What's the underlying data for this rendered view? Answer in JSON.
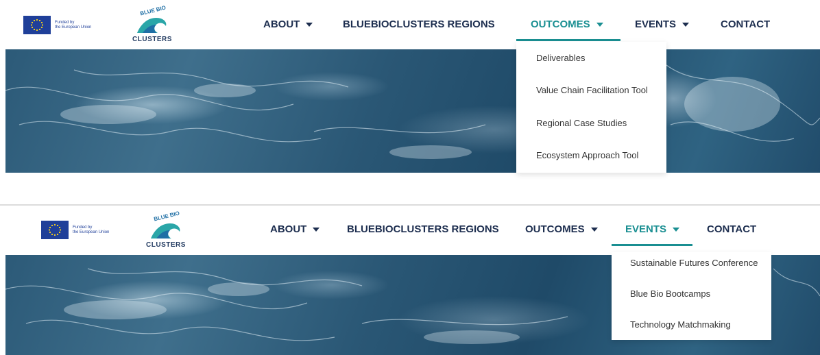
{
  "eu_logo": {
    "line1": "Funded by",
    "line2": "the European Union",
    "icon": "eu-flag-icon"
  },
  "brand": {
    "arc_text": "BLUE BIO",
    "name": "CLUSTERS",
    "icon": "wave-icon"
  },
  "screens": [
    {
      "nav": [
        {
          "label": "ABOUT"
        },
        {
          "label": "BLUEBIOCLUSTERS REGIONS"
        },
        {
          "label": "OUTCOMES"
        },
        {
          "label": "EVENTS"
        },
        {
          "label": "CONTACT"
        }
      ],
      "active": "OUTCOMES",
      "dropdown": [
        "Deliverables",
        "Value Chain Facilitation Tool",
        "Regional Case Studies",
        "Ecosystem Approach Tool"
      ]
    },
    {
      "nav": [
        {
          "label": "ABOUT"
        },
        {
          "label": "BLUEBIOCLUSTERS REGIONS"
        },
        {
          "label": "OUTCOMES"
        },
        {
          "label": "EVENTS"
        },
        {
          "label": "CONTACT"
        }
      ],
      "active": "EVENTS",
      "dropdown": [
        "Sustainable Futures Conference",
        "Blue Bio Bootcamps",
        "Technology Matchmaking"
      ]
    }
  ],
  "colors": {
    "accent": "#1a8f92",
    "nav_text": "#1d2e4f",
    "eu_blue": "#1f3f99"
  }
}
